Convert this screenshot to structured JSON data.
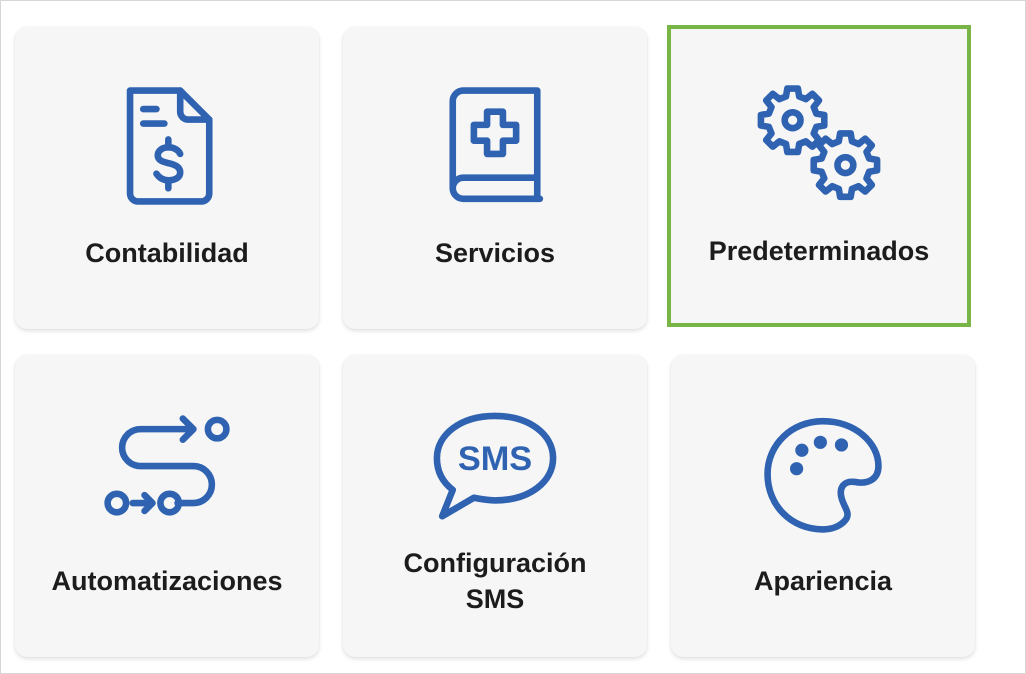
{
  "colors": {
    "icon": "#2f63b2",
    "tile_bg": "#f6f6f6",
    "selected_border": "#79b546",
    "label": "#1c1c1c"
  },
  "tiles": [
    {
      "label": "Contabilidad",
      "icon": "invoice-dollar-icon",
      "selected": false
    },
    {
      "label": "Servicios",
      "icon": "medical-book-icon",
      "selected": false
    },
    {
      "label": "Predeterminados",
      "icon": "gears-icon",
      "selected": true
    },
    {
      "label": "Automatizaciones",
      "icon": "workflow-route-icon",
      "selected": false
    },
    {
      "label_line1": "Configuración",
      "label_line2": "SMS",
      "icon": "sms-bubble-icon",
      "icon_text": "SMS",
      "selected": false
    },
    {
      "label": "Apariencia",
      "icon": "palette-icon",
      "selected": false
    }
  ]
}
